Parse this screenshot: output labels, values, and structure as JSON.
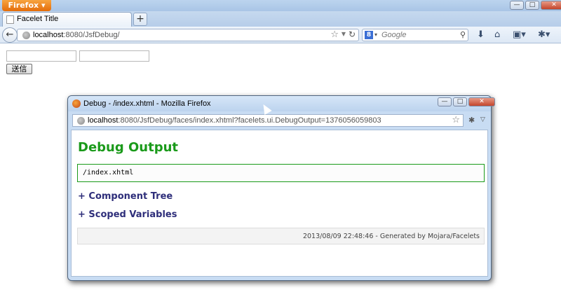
{
  "browser": {
    "menu_button": "Firefox ▾",
    "tab_title": "Facelet Title",
    "newtab": "+",
    "url_host": "localhost",
    "url_rest": ":8080/JsfDebug/",
    "search_engine": "8",
    "search_placeholder": "Google",
    "window_buttons": {
      "min": "—",
      "max": "□",
      "close": "✕"
    }
  },
  "page": {
    "submit_label": "送信"
  },
  "popup": {
    "title": "Debug - /index.xhtml - Mozilla Firefox",
    "url_host": "localhost",
    "url_rest": ":8080/JsfDebug/faces/index.xhtml?facelets.ui.DebugOutput=1376056059803",
    "heading": "Debug Output",
    "view_id": "/index.xhtml",
    "component_tree": "+ Component Tree",
    "scoped_variables": "+ Scoped Variables",
    "footer": "2013/08/09 22:48:46 - Generated by Mojara/Facelets",
    "window_buttons": {
      "min": "—",
      "max": "□",
      "close": "✕"
    }
  },
  "colors": {
    "heading": "#1a9a1a",
    "section_link": "#2e2e7a",
    "firefox_orange": "#e46c0a"
  }
}
